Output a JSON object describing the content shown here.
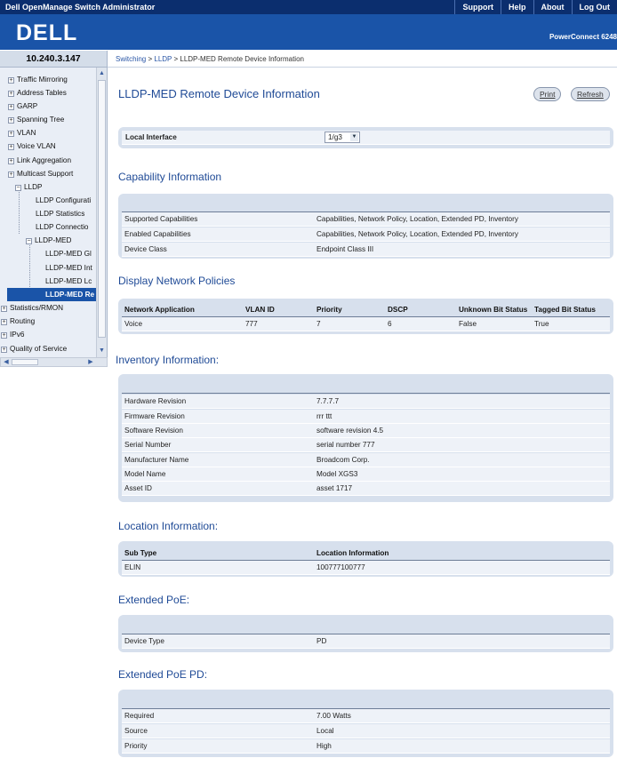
{
  "topbar": {
    "title": "Dell OpenManage Switch Administrator",
    "links": [
      "Support",
      "Help",
      "About",
      "Log Out"
    ]
  },
  "brand": {
    "logo": "DELL",
    "model": "PowerConnect 6248"
  },
  "ip": "10.240.3.147",
  "breadcrumb": {
    "links": [
      "Switching",
      "LLDP"
    ],
    "current": "LLDP-MED Remote Device Information",
    "sep": " > "
  },
  "sidebar": {
    "items": [
      {
        "label": "Traffic Mirroring",
        "pm": "+"
      },
      {
        "label": "Address Tables",
        "pm": "+"
      },
      {
        "label": "GARP",
        "pm": "+"
      },
      {
        "label": "Spanning Tree",
        "pm": "+"
      },
      {
        "label": "VLAN",
        "pm": "+"
      },
      {
        "label": "Voice VLAN",
        "pm": "+"
      },
      {
        "label": "Link Aggregation",
        "pm": "+"
      },
      {
        "label": "Multicast Support",
        "pm": "+"
      },
      {
        "label": "LLDP",
        "pm": "−"
      },
      {
        "label": "LLDP Configurati"
      },
      {
        "label": "LLDP Statistics"
      },
      {
        "label": "LLDP Connectio"
      },
      {
        "label": "LLDP-MED",
        "pm": "−"
      },
      {
        "label": "LLDP-MED Gl"
      },
      {
        "label": "LLDP-MED Int"
      },
      {
        "label": "LLDP-MED Lc"
      },
      {
        "label": "LLDP-MED Re"
      },
      {
        "label": "Statistics/RMON",
        "pm": "+"
      },
      {
        "label": "Routing",
        "pm": "+"
      },
      {
        "label": "IPv6",
        "pm": "+"
      },
      {
        "label": "Quality of Service",
        "pm": "+"
      }
    ]
  },
  "page": {
    "title": "LLDP-MED Remote Device Information",
    "print": "Print",
    "refresh": "Refresh"
  },
  "local_interface": {
    "label": "Local Interface",
    "value": "1/g3"
  },
  "capability": {
    "title": "Capability Information",
    "rows": [
      {
        "label": "Supported Capabilities",
        "value": "Capabilities, Network Policy, Location, Extended PD, Inventory"
      },
      {
        "label": "Enabled Capabilities",
        "value": "Capabilities, Network Policy, Location, Extended PD, Inventory"
      },
      {
        "label": "Device Class",
        "value": "Endpoint Class III"
      }
    ]
  },
  "policies": {
    "title": "Display Network Policies",
    "headers": [
      "Network Application",
      "VLAN ID",
      "Priority",
      "DSCP",
      "Unknown Bit Status",
      "Tagged Bit Status"
    ],
    "rows": [
      [
        "Voice",
        "777",
        "7",
        "6",
        "False",
        "True"
      ]
    ]
  },
  "inventory": {
    "title": "Inventory Information:",
    "rows": [
      {
        "label": "Hardware Revision",
        "value": "7.7.7.7"
      },
      {
        "label": "Firmware Revision",
        "value": "rrr ttt"
      },
      {
        "label": "Software Revision",
        "value": "software revision 4.5"
      },
      {
        "label": "Serial Number",
        "value": "serial number 777"
      },
      {
        "label": "Manufacturer Name",
        "value": "Broadcom Corp."
      },
      {
        "label": "Model Name",
        "value": "Model XGS3"
      },
      {
        "label": "Asset ID",
        "value": "asset 1717"
      }
    ]
  },
  "location": {
    "title": "Location Information:",
    "headers": [
      "Sub Type",
      "Location Information"
    ],
    "rows": [
      [
        "ELIN",
        "100777100777"
      ]
    ]
  },
  "ext_poe": {
    "title": "Extended PoE:",
    "rows": [
      {
        "label": "Device Type",
        "value": "PD"
      }
    ]
  },
  "ext_poe_pd": {
    "title": "Extended PoE PD:",
    "rows": [
      {
        "label": "Required",
        "value": "7.00 Watts"
      },
      {
        "label": "Source",
        "value": "Local"
      },
      {
        "label": "Priority",
        "value": "High"
      }
    ]
  }
}
